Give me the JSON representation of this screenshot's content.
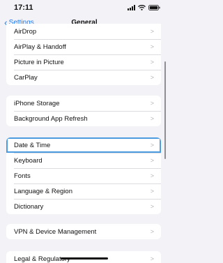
{
  "status_bar": {
    "time": "17:11",
    "icons": [
      "signal-icon",
      "wifi-icon",
      "battery-icon"
    ]
  },
  "nav": {
    "back_label": "Settings",
    "back_icon": "chevron-left-icon",
    "title": "General"
  },
  "groups": [
    {
      "items": [
        {
          "label": "AirDrop"
        },
        {
          "label": "AirPlay & Handoff"
        },
        {
          "label": "Picture in Picture"
        },
        {
          "label": "CarPlay"
        }
      ]
    },
    {
      "items": [
        {
          "label": "iPhone Storage"
        },
        {
          "label": "Background App Refresh"
        }
      ]
    },
    {
      "items": [
        {
          "label": "Date & Time",
          "highlighted": true
        },
        {
          "label": "Keyboard"
        },
        {
          "label": "Fonts"
        },
        {
          "label": "Language & Region"
        },
        {
          "label": "Dictionary"
        }
      ]
    },
    {
      "items": [
        {
          "label": "VPN & Device Management"
        }
      ]
    },
    {
      "items": [
        {
          "label": "Legal & Regulatory"
        }
      ]
    }
  ],
  "chevron_glyph": ">",
  "colors": {
    "accent": "#1e7cf2",
    "background": "#f2f2f7",
    "highlight_outline": "#4a9be0"
  }
}
